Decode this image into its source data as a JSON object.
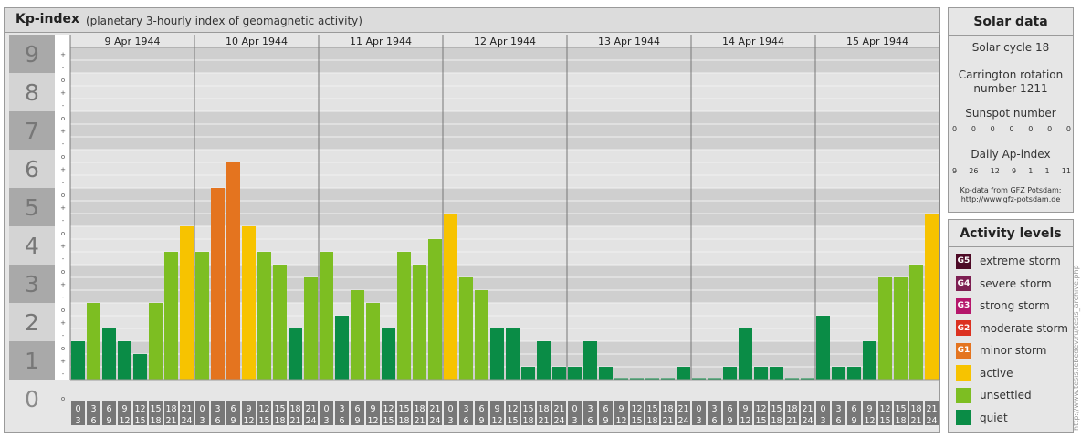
{
  "header": {
    "title": "Kp-index",
    "subtitle": "(planetary 3-hourly index of geomagnetic activity)"
  },
  "chart_data": {
    "type": "bar",
    "title": "Kp-index",
    "ylim": [
      0,
      9
    ],
    "y_labels": [
      "0",
      "1",
      "2",
      "3",
      "4",
      "5",
      "6",
      "7",
      "8",
      "9"
    ],
    "minor_marks": [
      "-",
      "+",
      "o"
    ],
    "days": [
      "9 Apr 1944",
      "10 Apr 1944",
      "11 Apr 1944",
      "12 Apr 1944",
      "13 Apr 1944",
      "14 Apr 1944",
      "15 Apr 1944"
    ],
    "interval_start": [
      "0",
      "3",
      "6",
      "9",
      "12",
      "15",
      "18",
      "21"
    ],
    "interval_end": [
      "3",
      "6",
      "9",
      "12",
      "15",
      "18",
      "21",
      "24"
    ],
    "values": [
      1.0,
      2.0,
      1.333,
      1.0,
      0.667,
      2.0,
      3.333,
      4.0,
      3.333,
      5.0,
      5.667,
      4.0,
      3.333,
      3.0,
      1.333,
      2.667,
      3.333,
      1.667,
      2.333,
      2.0,
      1.333,
      3.333,
      3.0,
      3.667,
      4.333,
      2.667,
      2.333,
      1.333,
      1.333,
      0.333,
      1.0,
      0.333,
      0.333,
      1.0,
      0.333,
      0.0,
      0.0,
      0.0,
      0.0,
      0.333,
      0.0,
      0.0,
      0.333,
      1.333,
      0.333,
      0.333,
      0.0,
      0.0,
      1.667,
      0.333,
      0.333,
      1.0,
      2.667,
      2.667,
      3.0,
      4.333
    ]
  },
  "solar_data": {
    "heading": "Solar data",
    "solar_cycle": "Solar cycle 18",
    "carrington_1": "Carrington rotation",
    "carrington_2": "number 1211",
    "sunspot_label": "Sunspot number",
    "sunspot_values": [
      "0",
      "0",
      "0",
      "0",
      "0",
      "0",
      "0"
    ],
    "ap_label": "Daily Ap-index",
    "ap_values": [
      "9",
      "26",
      "12",
      "9",
      "1",
      "1",
      "11"
    ],
    "credit_1": "Kp-data from  GFZ Potsdam:",
    "credit_2": "http://www.gfz-potsdam.de"
  },
  "activity_levels": {
    "heading": "Activity levels",
    "items": [
      {
        "code": "G5",
        "label": "extreme storm",
        "color": "#4d0a26"
      },
      {
        "code": "G4",
        "label": "severe storm",
        "color": "#7d1f52"
      },
      {
        "code": "G3",
        "label": "strong storm",
        "color": "#b5166b"
      },
      {
        "code": "G2",
        "label": "moderate storm",
        "color": "#dc3120"
      },
      {
        "code": "G1",
        "label": "minor storm",
        "color": "#e4741f"
      },
      {
        "code": "",
        "label": "active",
        "color": "#f7c300"
      },
      {
        "code": "",
        "label": "unsettled",
        "color": "#7dbe22"
      },
      {
        "code": "",
        "label": "quiet",
        "color": "#0a8c46"
      }
    ]
  },
  "side_credit": "http://www.tesis.lebedev.ru/tesis_archive.php"
}
